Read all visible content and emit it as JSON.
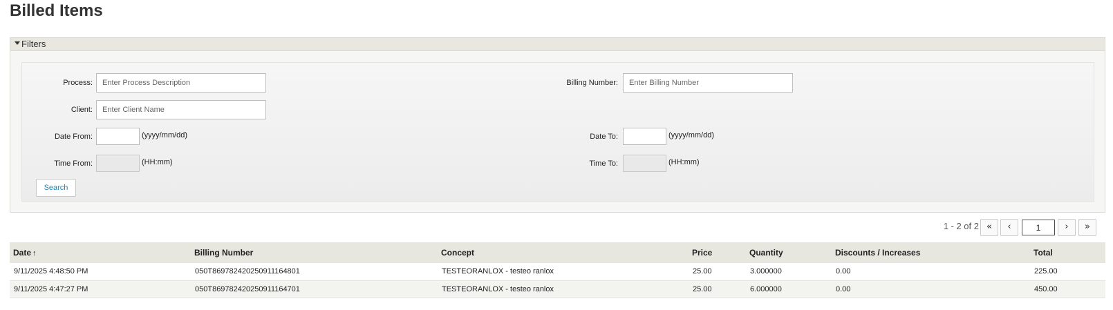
{
  "page": {
    "title": "Billed Items"
  },
  "filters": {
    "header": "Filters",
    "process": {
      "label": "Process:",
      "placeholder": "Enter Process Description",
      "value": ""
    },
    "billing_number": {
      "label": "Billing Number:",
      "placeholder": "Enter Billing Number",
      "value": ""
    },
    "client": {
      "label": "Client:",
      "placeholder": "Enter Client Name",
      "value": ""
    },
    "date_from": {
      "label": "Date From:",
      "hint": "(yyyy/mm/dd)",
      "value": ""
    },
    "date_to": {
      "label": "Date To:",
      "hint": "(yyyy/mm/dd)",
      "value": ""
    },
    "time_from": {
      "label": "Time From:",
      "hint": "(HH:mm)",
      "value": ""
    },
    "time_to": {
      "label": "Time To:",
      "hint": "(HH:mm)",
      "value": ""
    },
    "search_label": "Search"
  },
  "pager": {
    "info": "1 - 2 of 2",
    "first": "«",
    "prev": "‹",
    "page": "1",
    "next": "›",
    "last": "»"
  },
  "table": {
    "columns": [
      "Date",
      "Billing Number",
      "Concept",
      "Price",
      "Quantity",
      "Discounts / Increases",
      "Total"
    ],
    "sort_indicator": "↑",
    "rows": [
      [
        "9/11/2025 4:48:50 PM",
        "050T869782420250911164801",
        "TESTEORANLOX - testeo ranlox",
        "25.00",
        "3.000000",
        "0.00",
        "225.00"
      ],
      [
        "9/11/2025 4:47:27 PM",
        "050T869782420250911164701",
        "TESTEORANLOX - testeo ranlox",
        "25.00",
        "6.000000",
        "0.00",
        "450.00"
      ]
    ]
  }
}
